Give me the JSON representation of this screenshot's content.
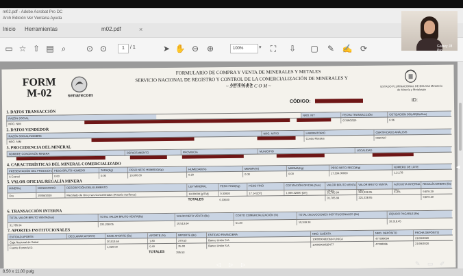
{
  "window": {
    "title": "m02.pdf - Adobe Acrobat Pro DC",
    "menu": "Arch  Edición  Ver  Ventana  Ayuda"
  },
  "tabs": [
    {
      "label": "Inicio"
    },
    {
      "label": "Herramientas"
    },
    {
      "label": "m02.pdf"
    }
  ],
  "toolbar": {
    "page_current": "1",
    "page_total": "/ 1",
    "zoom": "100%"
  },
  "status_bar": {
    "size": "8,50 x 11,00 pulg"
  },
  "webcam": {
    "name": "Galaxy J8 Pro"
  },
  "document": {
    "form_title_line1": "FORM",
    "form_title_line2": "M-02",
    "brand": "senarecom",
    "header_line1": "FORMULARIO DE COMPRA Y VENTA DE MINERALES Y METALES",
    "header_line2": "SERVICIO NACIONAL DE REGISTRO Y CONTROL DE LA COMERCIALIZACIÓN DE MINERALES Y METALES",
    "header_line3": "~ S E N A R E C O M ~",
    "seal_text": "ESTADO PLURINACIONAL DE BOLIVIA Ministerio de Minería y Metalurgia",
    "codigo_label": "CÓDIGO:",
    "id_label": "ID:",
    "sections": [
      {
        "num": "1.",
        "title": "DATOS TRANSACCIÓN"
      },
      {
        "num": "2.",
        "title": "DATOS VENDEDOR"
      },
      {
        "num": "3.",
        "title": "PROCEDENCIA DEL MINERAL"
      },
      {
        "num": "4.",
        "title": "CARACTERÍSTICAS DEL MINERAL COMERCIALIZADO"
      },
      {
        "num": "5.",
        "title": "VALOR OFICIAL/REGALÍA MINERA"
      },
      {
        "num": "6.",
        "title": "TRANSACCIÓN INTERNA"
      },
      {
        "num": "7.",
        "title": "APORTES INSTITUCIONALES"
      }
    ],
    "t1": {
      "headers": [
        "RAZÓN SOCIAL",
        "NRO. NIT",
        "FECHA TRANSACCIÓN",
        "COTIZACIÓN DÓLAR(Bs/Sus)"
      ],
      "values": [
        "NRO. NIM",
        "07/08/2020",
        "6.96"
      ]
    },
    "t2": {
      "headers": [
        "RAZÓN SOCIAL/NOMBRE",
        "NRO. NIT/CI",
        "LABORATORIO",
        "CERTIFICADO ANÁLISIS"
      ],
      "values": [
        "NRO. NIM",
        "Condo Morales",
        "0020427"
      ]
    },
    "t3": {
      "headers": [
        "NOMBRE CONCESIÓN MINERA",
        "DEPARTAMENTO",
        "PROVINCIA",
        "MUNICIPIO",
        "LOCALIDAD"
      ]
    },
    "t4": {
      "headers": [
        "PRESENTACIÓN DEL PRODUCTO",
        "PESO BRUTO HÚMEDO",
        "TARA(Kg)",
        "PESO NETO HÚMEDO(Kg)",
        "HUMEDAD(%)",
        "MERMA(%)",
        "MERMA(Kg)",
        "PESO NETO SECO(Kg)",
        "NÚMERO DE LOTE"
      ],
      "values": [
        "A Granel",
        "0.00",
        "0.00",
        "10,000.00",
        "0.20",
        "0.00",
        "0.00",
        "17,334.00000",
        "1,2,178"
      ]
    },
    "t5": {
      "headers": [
        "MINERAL",
        "MANDATARIO",
        "DESCRIPCIÓN DEL ELEMENTO",
        "LEY MINERAL",
        "PESO FINO(Kg)",
        "PESO FINO",
        "COTIZACIÓN OFICIAL(Sus)",
        "VALOR BRUTO VENTA (Sus)",
        "VALOR BRUTO VENTA (Bs)",
        "ALÍCUOTA INTERNA (%)",
        "REGALÍA MINERA (Bs)"
      ],
      "rows": [
        [
          "Oro",
          "20/08/2020",
          "Mezclado de Oro y sus Concentrados (Amonio Auríferos)",
          "19.00000 [g/TM]",
          "0.33920",
          "17.14 [OT]",
          "1,999.32000 [OT]",
          "31,785.94",
          "221,228.05",
          "4.2%",
          "9,879.29"
        ],
        [
          "",
          "",
          "",
          "",
          "",
          "",
          "",
          "31,785.94",
          "221,228.05",
          "",
          "9,879.29"
        ]
      ],
      "totals_label": "TOTALES",
      "totals_peso_fino": "0.33920"
    },
    "t6": {
      "headers": [
        "TOTAL VALOR BRUTO VENTA(Sus)",
        "TOTAL VALOR BRUTO VENTA(Bs)",
        "VALOR NETO VENTA (Bs)",
        "COSTO COMERCIALIZACIÓN (%)",
        "TOTAL DEDUCCIONES INSTITUCIONALES (Bs)",
        "LÍQUIDO PAGABLE (Bs)"
      ],
      "values": [
        "31,785.94",
        "221,228.05",
        "10,513.64",
        "51.20",
        "10,349.34",
        "10,318.45"
      ]
    },
    "t7": {
      "headers": [
        "ENTIDAD APORTE",
        "DECLARAR APORTE",
        "BASE APORTE (Bs)",
        "APORTE (%)",
        "IMPORTE (Bs)",
        "ENTIDAD FINANCIERA",
        "NRO. CUENTA",
        "NRO. DEPÓSITO",
        "FECHA DEPÓSITO"
      ],
      "rows": [
        [
          "Caja Nacional de Salud",
          "",
          "20,513.64",
          "1.80",
          "370.53",
          "Banco Unión S.A.",
          "10000004820694 UNICA",
          "477098094",
          "21/09/2020"
        ],
        [
          "Fuente Fomin M.D.",
          "",
          "1,020.00",
          "0.40",
          "25.00",
          "Banco Unión S.A.",
          "10000000028477",
          "47098386",
          "21/09/2020"
        ]
      ],
      "totals_label": "TOTALES",
      "totals_importe": "395.53"
    }
  }
}
